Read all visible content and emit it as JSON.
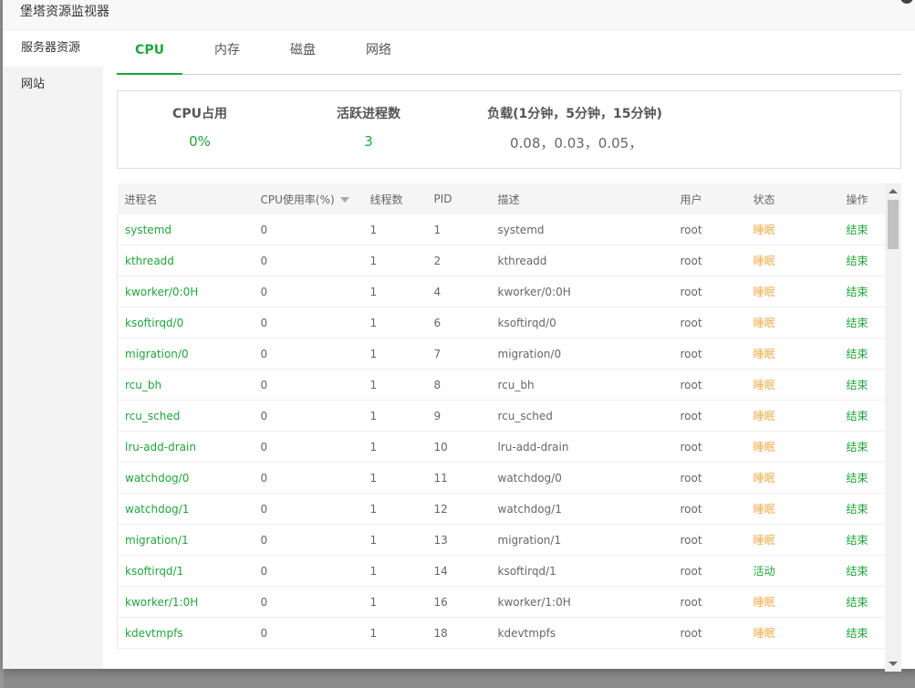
{
  "modal": {
    "title": "堡塔资源监视器",
    "close_glyph": "✕"
  },
  "sidebar": {
    "items": [
      {
        "label": "服务器资源",
        "active": true
      },
      {
        "label": "网站",
        "active": false
      }
    ]
  },
  "tabs": [
    {
      "label": "CPU",
      "active": true
    },
    {
      "label": "内存",
      "active": false
    },
    {
      "label": "磁盘",
      "active": false
    },
    {
      "label": "网络",
      "active": false
    }
  ],
  "stats": {
    "cpu": {
      "label": "CPU占用",
      "value": "0%"
    },
    "procs": {
      "label": "活跃进程数",
      "value": "3"
    },
    "load": {
      "label": "负载(1分钟，5分钟，15分钟)",
      "value": "0.08，0.03，0.05，"
    }
  },
  "table": {
    "headers": [
      "进程名",
      "CPU使用率(%)",
      "线程数",
      "PID",
      "描述",
      "用户",
      "状态",
      "操作"
    ],
    "rows": [
      [
        "systemd",
        "0",
        "1",
        "1",
        "systemd",
        "root",
        "睡眠",
        "结束"
      ],
      [
        "kthreadd",
        "0",
        "1",
        "2",
        "kthreadd",
        "root",
        "睡眠",
        "结束"
      ],
      [
        "kworker/0:0H",
        "0",
        "1",
        "4",
        "kworker/0:0H",
        "root",
        "睡眠",
        "结束"
      ],
      [
        "ksoftirqd/0",
        "0",
        "1",
        "6",
        "ksoftirqd/0",
        "root",
        "睡眠",
        "结束"
      ],
      [
        "migration/0",
        "0",
        "1",
        "7",
        "migration/0",
        "root",
        "睡眠",
        "结束"
      ],
      [
        "rcu_bh",
        "0",
        "1",
        "8",
        "rcu_bh",
        "root",
        "睡眠",
        "结束"
      ],
      [
        "rcu_sched",
        "0",
        "1",
        "9",
        "rcu_sched",
        "root",
        "睡眠",
        "结束"
      ],
      [
        "lru-add-drain",
        "0",
        "1",
        "10",
        "lru-add-drain",
        "root",
        "睡眠",
        "结束"
      ],
      [
        "watchdog/0",
        "0",
        "1",
        "11",
        "watchdog/0",
        "root",
        "睡眠",
        "结束"
      ],
      [
        "watchdog/1",
        "0",
        "1",
        "12",
        "watchdog/1",
        "root",
        "睡眠",
        "结束"
      ],
      [
        "migration/1",
        "0",
        "1",
        "13",
        "migration/1",
        "root",
        "睡眠",
        "结束"
      ],
      [
        "ksoftirqd/1",
        "0",
        "1",
        "14",
        "ksoftirqd/1",
        "root",
        "活动",
        "结束"
      ],
      [
        "kworker/1:0H",
        "0",
        "1",
        "16",
        "kworker/1:0H",
        "root",
        "睡眠",
        "结束"
      ],
      [
        "kdevtmpfs",
        "0",
        "1",
        "18",
        "kdevtmpfs",
        "root",
        "睡眠",
        "结束"
      ]
    ]
  },
  "colors": {
    "accent": "#20a53a",
    "sleep": "#f0ad4e"
  }
}
